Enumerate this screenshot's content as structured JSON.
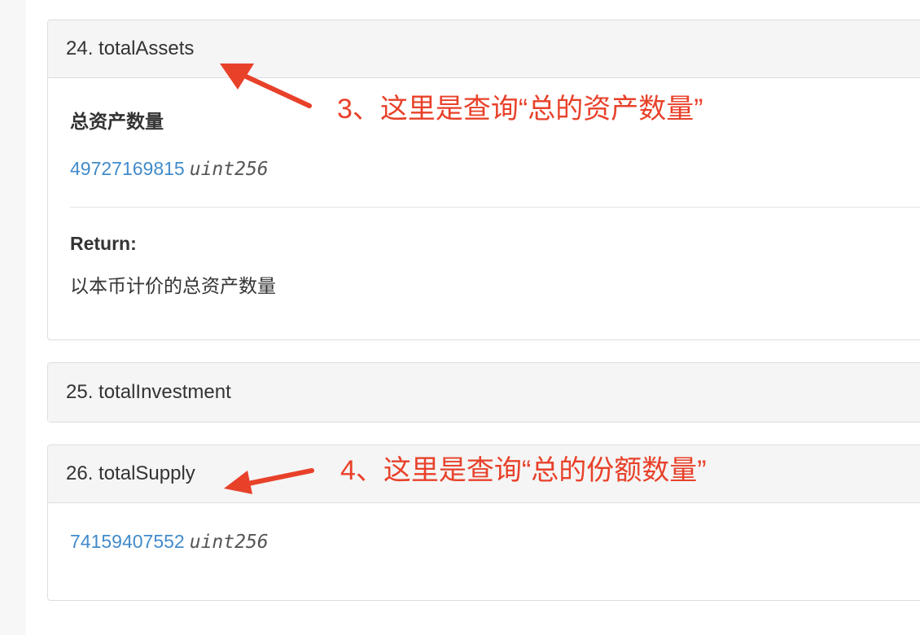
{
  "sections": [
    {
      "heading": "24. totalAssets",
      "description": "总资产数量",
      "value": "49727169815",
      "type": "uint256",
      "return_label": "Return:",
      "return_text": "以本币计价的总资产数量"
    },
    {
      "heading": "25. totalInvestment"
    },
    {
      "heading": "26. totalSupply",
      "value": "74159407552",
      "type": "uint256"
    }
  ],
  "annotations": [
    "3、这里是查询“总的资产数量”",
    "4、这里是查询“总的份额数量”"
  ],
  "colors": {
    "annotation": "#e8412a",
    "link": "#428bca"
  }
}
